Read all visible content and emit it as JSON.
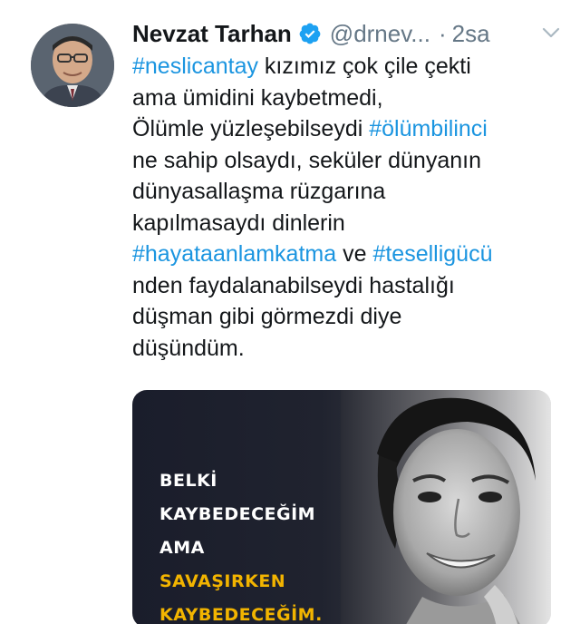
{
  "author": {
    "name": "Nevzat Tarhan",
    "handle": "@drnev...",
    "separator": "·",
    "time": "2sa",
    "verified": true
  },
  "icons": {
    "verified": "verified-badge-icon",
    "menu": "chevron-down-icon"
  },
  "tweet_lines": [
    [
      {
        "text": "#neslicantay",
        "hashtag": true
      },
      {
        "text": " kızımız çok çile çekti",
        "hashtag": false
      }
    ],
    [
      {
        "text": "ama ümidini kaybetmedi,",
        "hashtag": false
      }
    ],
    [
      {
        "text": "Ölümle yüzleşebilseydi ",
        "hashtag": false
      },
      {
        "text": "#ölümbilinci",
        "hashtag": true
      }
    ],
    [
      {
        "text": "ne sahip olsaydı, seküler dünyanın",
        "hashtag": false
      }
    ],
    [
      {
        "text": "dünyasallaşma rüzgarına",
        "hashtag": false
      }
    ],
    [
      {
        "text": "kapılmasaydı dinlerin",
        "hashtag": false
      }
    ],
    [
      {
        "text": "#hayataanlamkatma",
        "hashtag": true
      },
      {
        "text": " ve ",
        "hashtag": false
      },
      {
        "text": "#teselligücü",
        "hashtag": true
      }
    ],
    [
      {
        "text": "nden faydalanabilseydi hastalığı",
        "hashtag": false
      }
    ],
    [
      {
        "text": "düşman gibi görmezdi diye",
        "hashtag": false
      }
    ],
    [
      {
        "text": "düşündüm.",
        "hashtag": false
      }
    ]
  ],
  "media": {
    "lines": [
      {
        "text": "BELKİ",
        "color": "#ffffff"
      },
      {
        "text": "KAYBEDECEĞİM",
        "color": "#ffffff"
      },
      {
        "text": "AMA",
        "color": "#ffffff"
      },
      {
        "text": "SAVAŞIRKEN",
        "color": "#f2b400"
      },
      {
        "text": "KAYBEDECEĞİM.",
        "color": "#f2b400"
      }
    ]
  },
  "colors": {
    "hashtag": "#1b95e0",
    "secondary_text": "#657786",
    "verified": "#1da1f2",
    "poster_highlight": "#f2b400"
  }
}
